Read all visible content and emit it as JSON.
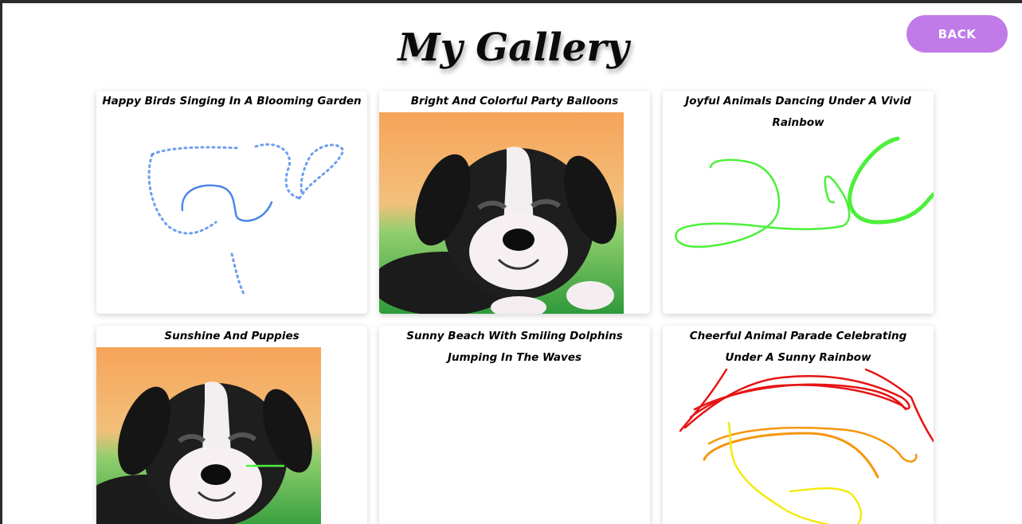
{
  "header": {
    "title": "My Gallery",
    "back_label": "BACK"
  },
  "colors": {
    "back_button": "#c07be9",
    "stroke_blue": "#4a86e8",
    "stroke_green": "#4cf03a",
    "stroke_red": "#e61414",
    "stroke_orange": "#f5960f",
    "stroke_yellow": "#f3ea10"
  },
  "gallery": {
    "cards": [
      {
        "title": "Happy Birds Singing In A Blooming Garden",
        "art": "blue-doodle"
      },
      {
        "title": "Bright And Colorful Party Balloons",
        "art": "puppy-image"
      },
      {
        "title": "Joyful Animals Dancing Under A Vivid Rainbow",
        "art": "green-doodle"
      },
      {
        "title": "Sunshine And Puppies",
        "art": "puppy-image-with-line"
      },
      {
        "title": "Sunny Beach With Smiling Dolphins Jumping In The Waves",
        "art": "empty"
      },
      {
        "title": "Cheerful Animal Parade Celebrating Under A Sunny Rainbow",
        "art": "rainbow-doodle"
      }
    ]
  }
}
